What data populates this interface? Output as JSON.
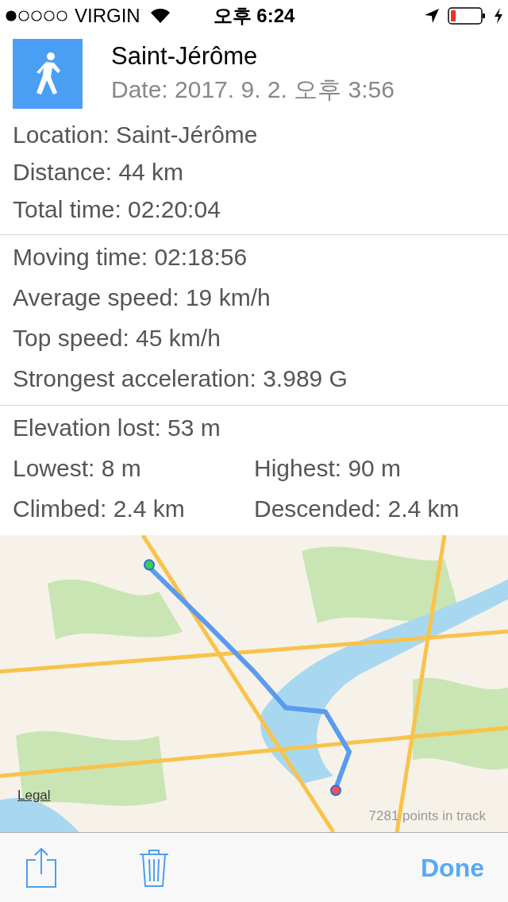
{
  "status_bar": {
    "carrier": "VIRGIN",
    "time": "오후 6:24"
  },
  "header": {
    "title": "Saint-Jérôme",
    "date": "Date: 2017. 9. 2. 오후 3:56"
  },
  "sections": [
    {
      "rows": [
        [
          "Location: Saint-Jérôme"
        ],
        [
          "Distance: 44 km"
        ],
        [
          "Total time: 02:20:04"
        ]
      ]
    },
    {
      "rows": [
        [
          "Moving time: 02:18:56"
        ],
        [
          "Average speed: 19 km/h"
        ],
        [
          "Top speed: 45 km/h"
        ],
        [
          "Strongest acceleration: 3.989 G"
        ]
      ]
    },
    {
      "rows": [
        [
          "Elevation lost: 53 m"
        ],
        [
          "Lowest: 8 m",
          "Highest: 90 m"
        ],
        [
          "Climbed: 2.4 km",
          "Descended: 2.4 km"
        ]
      ]
    }
  ],
  "map": {
    "legal": "Legal",
    "points": "7281 points in track"
  },
  "toolbar": {
    "done": "Done"
  }
}
